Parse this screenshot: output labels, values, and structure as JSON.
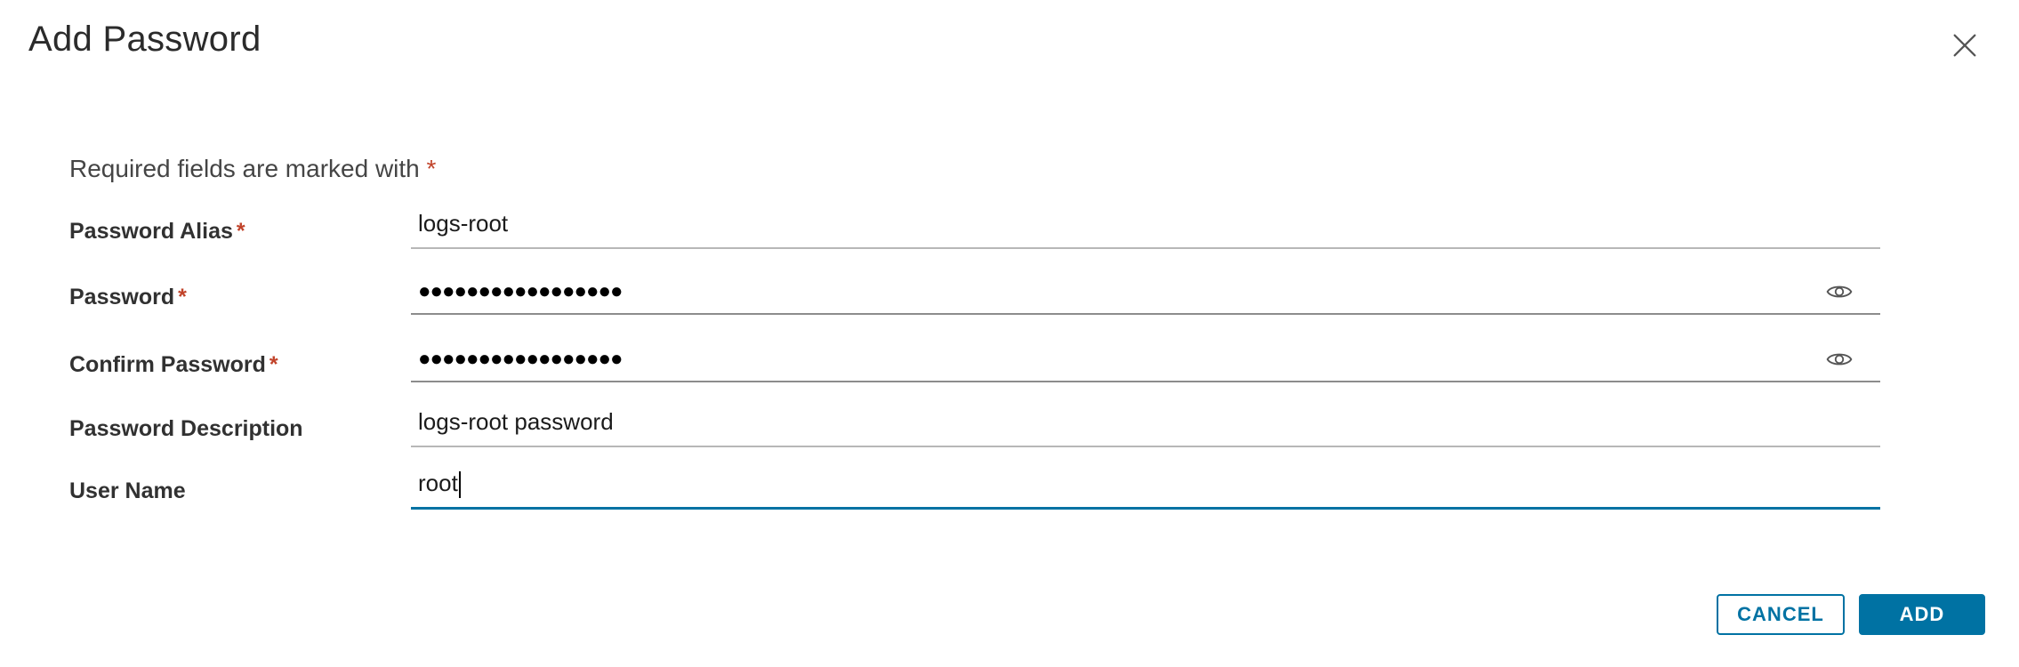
{
  "dialog": {
    "title": "Add Password",
    "required_note": "Required fields are marked with",
    "required_marker": "*"
  },
  "fields": [
    {
      "label": "Password Alias",
      "required": true,
      "type": "text",
      "value": "logs-root"
    },
    {
      "label": "Password",
      "required": true,
      "type": "password",
      "value": "●●●●●●●●●●●●●●●●●"
    },
    {
      "label": "Confirm Password",
      "required": true,
      "type": "password",
      "value": "●●●●●●●●●●●●●●●●●"
    },
    {
      "label": "Password Description",
      "required": false,
      "type": "text",
      "value": "logs-root password"
    },
    {
      "label": "User Name",
      "required": false,
      "type": "text",
      "value": "root",
      "focused": true
    }
  ],
  "buttons": {
    "cancel": "CANCEL",
    "add": "ADD"
  },
  "icons": {
    "close": "close-icon",
    "show_password": "eye-icon"
  },
  "colors": {
    "accent": "#0072a3",
    "required": "#c1432a"
  }
}
